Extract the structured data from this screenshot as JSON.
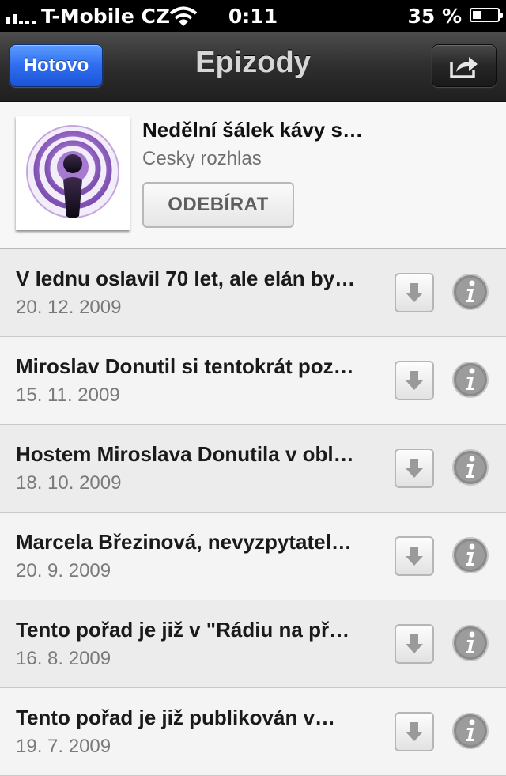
{
  "status_bar": {
    "carrier": "T-Mobile CZ",
    "time": "0:11",
    "battery_percent": "35 %",
    "battery_level": 0.35
  },
  "nav": {
    "done_label": "Hotovo",
    "title": "Epizody",
    "share_icon": "share-arrow-icon"
  },
  "podcast": {
    "title": "Nedělní šálek kávy s…",
    "author": "Cesky rozhlas",
    "subscribe_label": "ODEBÍRAT",
    "artwork_icon": "podcast-icon"
  },
  "episodes": [
    {
      "title": "V lednu oslavil 70 let, ale elán by…",
      "date": "20. 12. 2009"
    },
    {
      "title": "Miroslav Donutil si tentokrát poz…",
      "date": "15. 11. 2009"
    },
    {
      "title": "Hostem Miroslava Donutila v obl…",
      "date": "18. 10. 2009"
    },
    {
      "title": "Marcela Březinová, nevyzpytatel…",
      "date": "20. 9. 2009"
    },
    {
      "title": "Tento pořad je již v \"Rádiu na př…",
      "date": "16. 8. 2009"
    },
    {
      "title": "Tento pořad je již publikován v…",
      "date": "19. 7. 2009"
    }
  ],
  "colors": {
    "done_button": "#2e6ef0",
    "navbar": "#2e2e2e",
    "list_background": "#f2f2f2"
  }
}
